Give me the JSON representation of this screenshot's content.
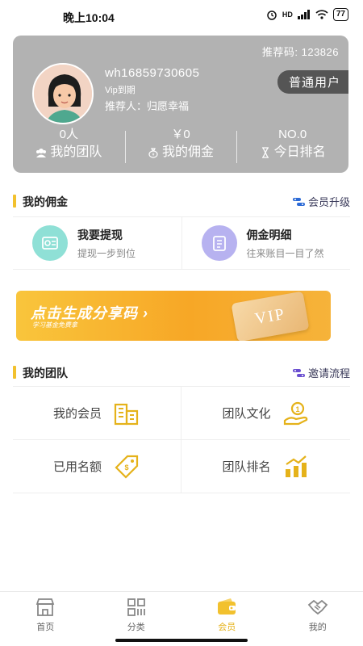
{
  "status_bar": {
    "time": "晚上10:04",
    "battery": "77",
    "network": "HD"
  },
  "profile": {
    "referral_code": "推荐码: 123826",
    "username": "wh16859730605",
    "vip_status": "Vip到期",
    "referrer": "推荐人：归愿幸福",
    "user_type": "普通用户"
  },
  "stats": [
    {
      "value": "0人",
      "label": "我的团队",
      "icon": "team-icon"
    },
    {
      "value": "￥0",
      "label": "我的佣金",
      "icon": "money-bag-icon"
    },
    {
      "value": "NO.0",
      "label": "今日排名",
      "icon": "hourglass-icon"
    }
  ],
  "commission_section": {
    "title": "我的佣金",
    "link": "会员升级"
  },
  "commission_items": [
    {
      "title": "我要提现",
      "subtitle": "提现一步到位",
      "icon": "withdraw-icon"
    },
    {
      "title": "佣金明细",
      "subtitle": "往来账目一目了然",
      "icon": "ledger-icon"
    }
  ],
  "banner": {
    "title": "点击生成分享码",
    "subtitle": "学习基金免费拿",
    "card_text": "VIP"
  },
  "team_section": {
    "title": "我的团队",
    "link": "邀请流程"
  },
  "team_items": [
    {
      "label": "我的会员",
      "icon": "building-icon"
    },
    {
      "label": "团队文化",
      "icon": "coin-hand-icon"
    },
    {
      "label": "已用名额",
      "icon": "price-tag-icon"
    },
    {
      "label": "团队排名",
      "icon": "bar-chart-icon"
    }
  ],
  "tabbar": [
    {
      "label": "首页",
      "icon": "shop-icon"
    },
    {
      "label": "分类",
      "icon": "grid-icon"
    },
    {
      "label": "会员",
      "icon": "wallet-icon"
    },
    {
      "label": "我的",
      "icon": "handshake-icon"
    }
  ],
  "active_tab": "会员",
  "colors": {
    "accent": "#f2c12e",
    "card_bg": "#b2b2b2",
    "usertype_bg": "#555555",
    "banner_orange": "#f7a726",
    "withdraw_circle": "#8fe0d6",
    "ledger_circle": "#b7b2f0"
  }
}
